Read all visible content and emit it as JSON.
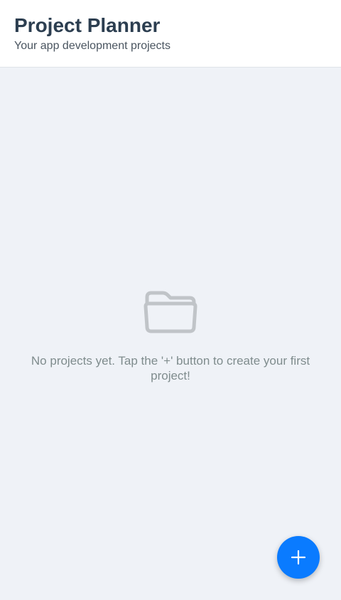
{
  "header": {
    "title": "Project Planner",
    "subtitle": "Your app development projects"
  },
  "empty_state": {
    "icon": "folder-icon",
    "message": "No projects yet. Tap the '+' button to create your first project!"
  },
  "fab": {
    "icon": "plus-icon",
    "aria_label": "+"
  },
  "colors": {
    "accent": "#0a7bff",
    "background": "#eff2f7",
    "title": "#2c3e50",
    "muted_text": "#7f8c8d",
    "icon_gray": "#c0c4c8"
  }
}
